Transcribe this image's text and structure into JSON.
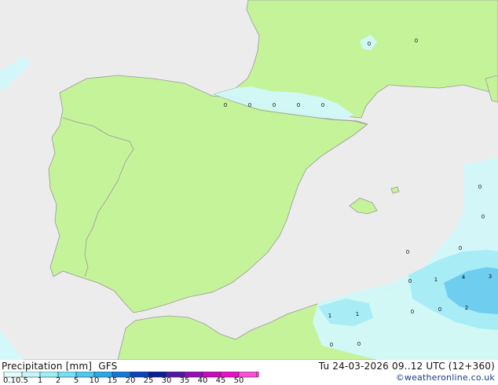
{
  "legend": {
    "title": "Precipitation [mm]",
    "model": "GFS",
    "ticks": [
      "0.1",
      "0.5",
      "1",
      "2",
      "5",
      "10",
      "15",
      "20",
      "25",
      "30",
      "35",
      "40",
      "45",
      "50"
    ],
    "colors": [
      "#e3fcfc",
      "#c4f6fa",
      "#9ceef8",
      "#74e0f4",
      "#4ccaf0",
      "#2aa8e6",
      "#1478d8",
      "#0c44be",
      "#0a1e96",
      "#5418a8",
      "#9410b4",
      "#c80cbe",
      "#e810c8",
      "#f850d8"
    ]
  },
  "valid_time": "Tu 24-03-2026 09..12 UTC (12+360)",
  "copyright": "©weatheronline.co.uk",
  "map_colors": {
    "land": "#c5f39a",
    "sea": "#ececec",
    "border": "#999999",
    "precip_light": "#d2f8fa",
    "precip_mid": "#a8ecf6",
    "precip_heavy": "#6fcdf0"
  },
  "precip_labels": [
    "0",
    "0",
    "0",
    "0",
    "0",
    "0",
    "0",
    "0",
    "0",
    "0",
    "0",
    "0",
    "1",
    "4",
    "3",
    "2",
    "1",
    "1",
    "0",
    "0",
    "0",
    "0"
  ]
}
